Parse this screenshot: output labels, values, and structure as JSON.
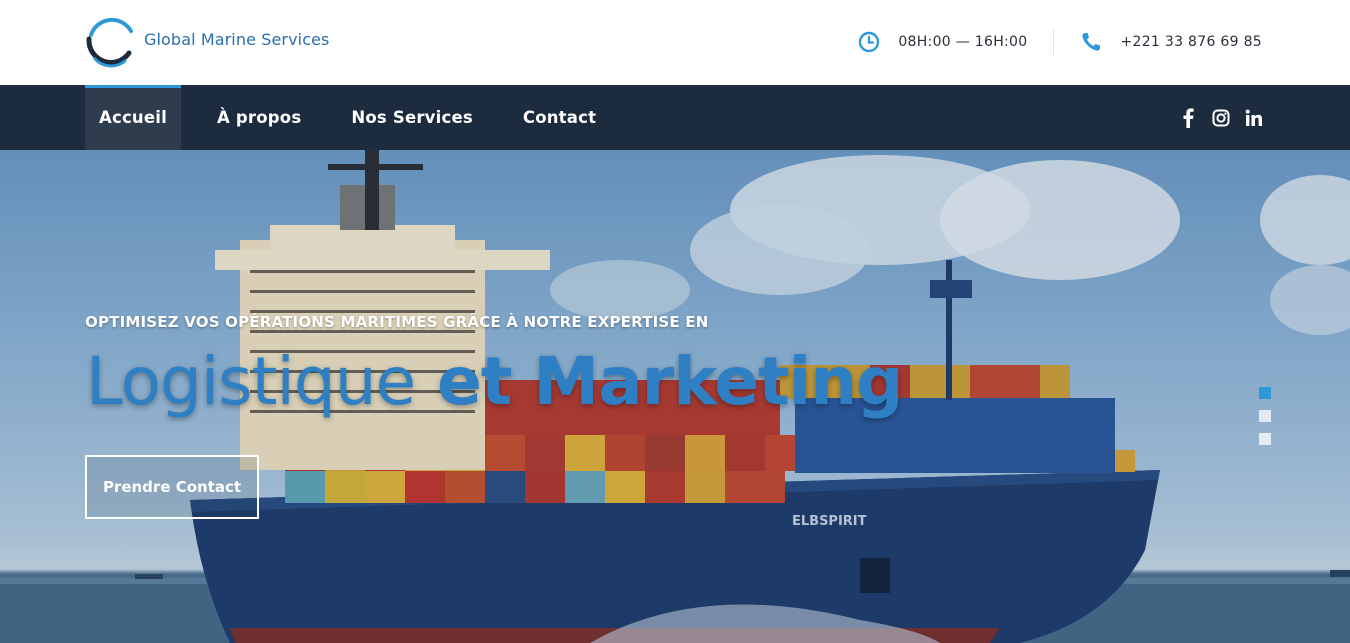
{
  "brand": {
    "name": "Global Marine Services",
    "colors": {
      "primary": "#2e7fc4",
      "navy": "#1c2b3e",
      "accent": "#2e98d8"
    }
  },
  "header": {
    "hours": {
      "icon": "clock-icon",
      "text": "08H:00 — 16H:00"
    },
    "phone": {
      "icon": "phone-icon",
      "text": "+221 33 876 69 85"
    }
  },
  "nav": {
    "items": [
      {
        "label": "Accueil",
        "active": true
      },
      {
        "label": "À propos",
        "active": false
      },
      {
        "label": "Nos Services",
        "active": false
      },
      {
        "label": "Contact",
        "active": false
      }
    ],
    "social": [
      "facebook-icon",
      "instagram-icon",
      "linkedin-icon"
    ]
  },
  "hero": {
    "subtitle": "OPTIMISEZ VOS OPÉRATIONS MARITIMES GRÂCE À NOTRE EXPERTISE EN",
    "title_part1": "Logistique",
    "title_part2": "et Marketing",
    "cta_label": "Prendre Contact",
    "ship_name": "ELBSPIRIT",
    "slides": 3,
    "active_slide": 1
  }
}
